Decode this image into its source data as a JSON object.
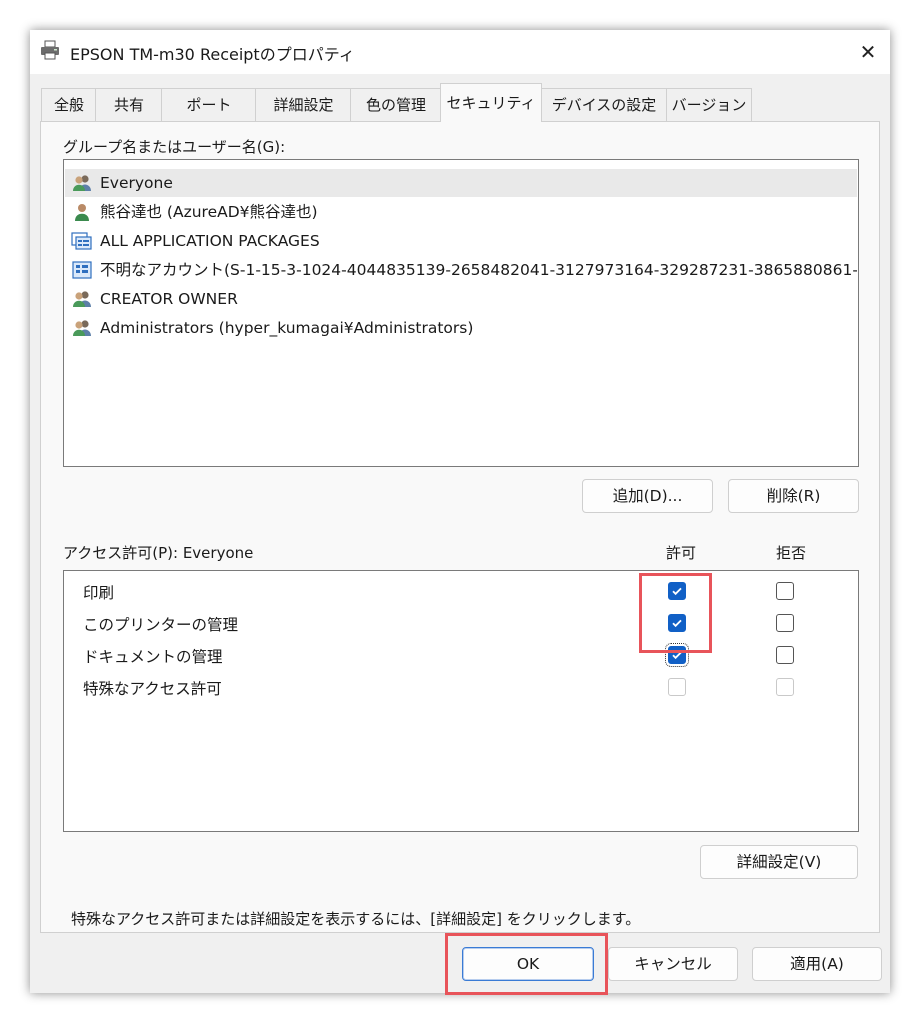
{
  "window": {
    "title": "EPSON TM-m30 Receiptのプロパティ",
    "close_glyph": "✕"
  },
  "tabs": [
    {
      "label": "全般",
      "active": false
    },
    {
      "label": "共有",
      "active": false
    },
    {
      "label": "ポート",
      "active": false
    },
    {
      "label": "詳細設定",
      "active": false
    },
    {
      "label": "色の管理",
      "active": false
    },
    {
      "label": "セキュリティ",
      "active": true
    },
    {
      "label": "デバイスの設定",
      "active": false
    },
    {
      "label": "バージョン",
      "active": false
    }
  ],
  "groups": {
    "label": "グループ名またはユーザー名(G):",
    "items": [
      {
        "name": "Everyone",
        "icon": "users-icon",
        "selected": true
      },
      {
        "name": "熊谷達也 (AzureAD¥熊谷達也)",
        "icon": "user-icon",
        "selected": false
      },
      {
        "name": "ALL APPLICATION PACKAGES",
        "icon": "app-packages-icon",
        "selected": false
      },
      {
        "name": "不明なアカウント(S-1-15-3-1024-4044835139-2658482041-3127973164-329287231-3865880861-...",
        "icon": "unknown-account-icon",
        "selected": false
      },
      {
        "name": "CREATOR OWNER",
        "icon": "users-icon",
        "selected": false
      },
      {
        "name": "Administrators (hyper_kumagai¥Administrators)",
        "icon": "users-icon",
        "selected": false
      }
    ],
    "add_button": "追加(D)...",
    "remove_button": "削除(R)"
  },
  "permissions": {
    "label": "アクセス許可(P): Everyone",
    "allow_header": "許可",
    "deny_header": "拒否",
    "items": [
      {
        "name": "印刷",
        "allow": "checked",
        "deny": "unchecked"
      },
      {
        "name": "このプリンターの管理",
        "allow": "checked",
        "deny": "unchecked"
      },
      {
        "name": "ドキュメントの管理",
        "allow": "checked",
        "deny": "unchecked"
      },
      {
        "name": "特殊なアクセス許可",
        "allow": "disabled",
        "deny": "disabled"
      }
    ]
  },
  "hint": "特殊なアクセス許可または詳細設定を表示するには、[詳細設定] をクリックします。",
  "advanced_button": "詳細設定(V)",
  "footer": {
    "ok": "OK",
    "cancel": "キャンセル",
    "apply": "適用(A)"
  },
  "colors": {
    "accent": "#1160c6",
    "highlight": "#e8545a",
    "dialog_bg": "#f0f0f0"
  }
}
